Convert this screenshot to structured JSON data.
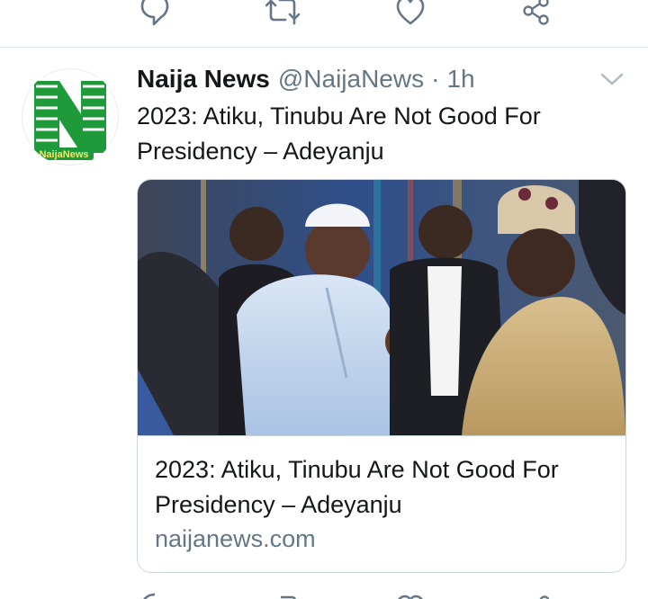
{
  "actions_top": [
    {
      "icon": "reply-icon"
    },
    {
      "icon": "retweet-icon"
    },
    {
      "icon": "like-icon"
    },
    {
      "icon": "share-icon"
    }
  ],
  "tweet": {
    "display_name": "Naija News",
    "handle": "@NaijaNews",
    "separator": "·",
    "time": "1h",
    "text": "2023: Atiku, Tinubu Are Not Good For Presidency – Adeyanju",
    "avatar_logo_text": "NaijaNews",
    "menu_icon": "chevron-down-icon",
    "card": {
      "title": "2023: Atiku, Tinubu Are Not Good For Presidency – Adeyanju",
      "domain": "naijanews.com"
    }
  },
  "colors": {
    "text": "#14171a",
    "secondary": "#657786",
    "border": "#ccd6dd",
    "logo_green": "#1f9a3a"
  }
}
